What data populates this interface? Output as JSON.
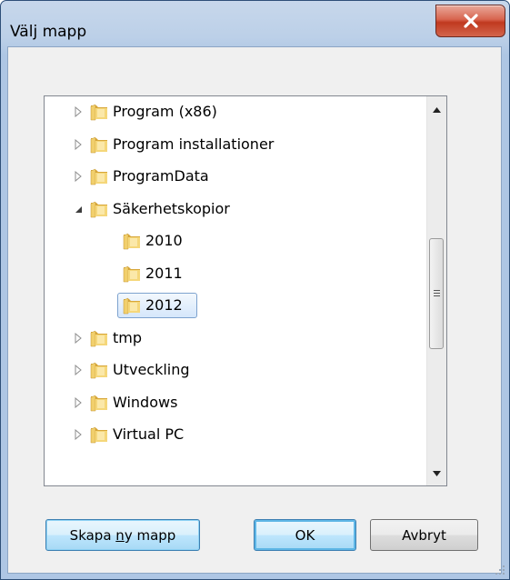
{
  "window": {
    "title": "Välj mapp"
  },
  "tree": {
    "items": [
      {
        "label": "Program (x86)",
        "expander": "collapsed",
        "level": 0,
        "selected": false
      },
      {
        "label": "Program installationer",
        "expander": "collapsed",
        "level": 0,
        "selected": false
      },
      {
        "label": "ProgramData",
        "expander": "collapsed",
        "level": 0,
        "selected": false
      },
      {
        "label": "Säkerhetskopior",
        "expander": "expanded",
        "level": 0,
        "selected": false
      },
      {
        "label": "2010",
        "expander": "none",
        "level": 1,
        "selected": false
      },
      {
        "label": "2011",
        "expander": "none",
        "level": 1,
        "selected": false
      },
      {
        "label": "2012",
        "expander": "none",
        "level": 1,
        "selected": true
      },
      {
        "label": "tmp",
        "expander": "collapsed",
        "level": 0,
        "selected": false
      },
      {
        "label": "Utveckling",
        "expander": "collapsed",
        "level": 0,
        "selected": false
      },
      {
        "label": "Windows",
        "expander": "collapsed",
        "level": 0,
        "selected": false
      },
      {
        "label": "Virtual PC",
        "expander": "collapsed",
        "level": 0,
        "selected": false
      }
    ]
  },
  "buttons": {
    "new_folder_prefix": "Skapa ",
    "new_folder_mnemonic": "n",
    "new_folder_suffix": "y mapp",
    "ok": "OK",
    "cancel": "Avbryt"
  },
  "icons": {
    "close": "close-icon",
    "folder": "folder-icon",
    "expander_collapsed": "triangle-right-icon",
    "expander_expanded": "triangle-down-icon",
    "scroll_up": "arrow-up-icon",
    "scroll_down": "arrow-down-icon"
  },
  "colors": {
    "selection_border": "#7da2ce",
    "close_button": "#c0391f",
    "folder": "#e8c25a"
  }
}
